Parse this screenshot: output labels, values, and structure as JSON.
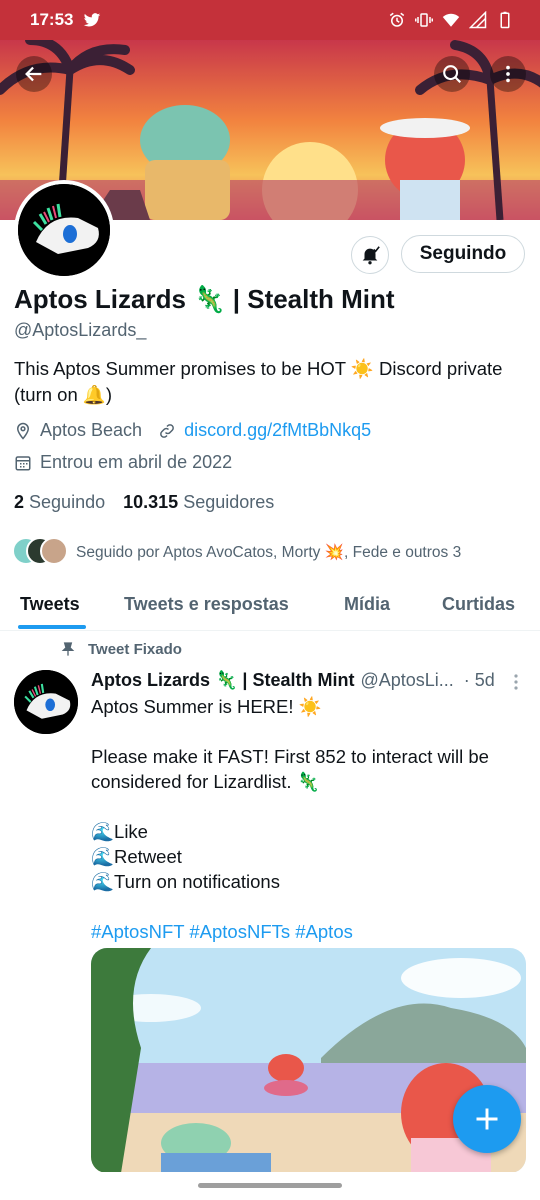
{
  "status_bar": {
    "time": "17:53"
  },
  "profile": {
    "follow_button": "Seguindo",
    "name": "Aptos Lizards 🦎 | Stealth Mint",
    "handle": "@AptosLizards_",
    "bio": "This Aptos Summer promises to be HOT ☀️ Discord private (turn on 🔔)",
    "location": "Aptos Beach",
    "website": "discord.gg/2fMtBbNkq5",
    "joined": "Entrou em abril de 2022",
    "following_count": "2",
    "following_label": "Seguindo",
    "followers_count": "10.315",
    "followers_label": "Seguidores",
    "followed_by": "Seguido por Aptos AvoCatos, Morty 💥, Fede e outros 3"
  },
  "tabs": [
    "Tweets",
    "Tweets e respostas",
    "Mídia",
    "Curtidas"
  ],
  "pinned_tweet": {
    "pinned_label": "Tweet Fixado",
    "author_name": "Aptos Lizards 🦎 | Stealth Mint",
    "author_handle": "@AptosLi...",
    "time": "· 5d",
    "text": "Aptos Summer is HERE! ☀️\n\nPlease make it FAST! First 852 to interact will be considered for Lizardlist. 🦎\n\n🌊Like\n🌊Retweet\n🌊Turn on notifications",
    "hashtags": "#AptosNFT #AptosNFTs #Aptos"
  },
  "colors": {
    "accent": "#1d9bf0",
    "status_bar": "#c4313a"
  }
}
